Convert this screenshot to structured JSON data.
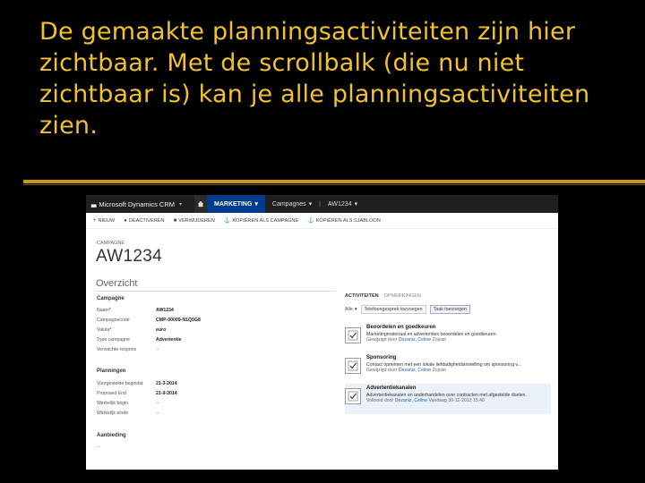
{
  "slide": {
    "title": "De gemaakte planningsactiviteiten zijn hier zichtbaar. Met de scrollbalk (die nu niet zichtbaar is) kan je alle planningsactiviteiten zien."
  },
  "navbar": {
    "logo_mark": "▃",
    "app_name": "Microsoft Dynamics CRM",
    "items": [
      {
        "label": "MARKETING"
      },
      {
        "label": "Campagnes"
      },
      {
        "label": "AW1234"
      }
    ]
  },
  "commands": [
    {
      "icon": "+",
      "label": "NIEUW"
    },
    {
      "icon": "●",
      "label": "DEACTIVEREN"
    },
    {
      "icon": "■",
      "label": "VERWIJDEREN"
    },
    {
      "icon": "⚓",
      "label": "KOPIËREN ALS CAMPAGNE"
    },
    {
      "icon": "⚓",
      "label": "KOPIËREN ALS SJABLOON"
    }
  ],
  "record": {
    "entity": "CAMPAGNE",
    "title": "AW1234",
    "section": "Overzicht"
  },
  "groups": {
    "campaign": {
      "title": "Campagne",
      "fields": [
        {
          "label": "Naam",
          "required": "*",
          "value": "AW1234",
          "bold": true
        },
        {
          "label": "Campagnecode",
          "required": "",
          "value": "CMP-00009-N1Q5G8",
          "bold": true
        },
        {
          "label": "Valuta",
          "required": "*",
          "value": "euro",
          "bold": true
        },
        {
          "label": "Type campagne",
          "required": "",
          "value": "Advertentie",
          "bold": true
        },
        {
          "label": "Verwachte respons",
          "required": "",
          "value": "--",
          "bold": false
        }
      ]
    },
    "planning": {
      "title": "Planningen",
      "fields": [
        {
          "label": "Voorgestelde begindat",
          "value": "21-3-2014",
          "bold": true
        },
        {
          "label": "Proposed End",
          "value": "21-9-2014",
          "bold": true
        },
        {
          "label": "Werkelijk begin",
          "value": "--",
          "bold": false
        },
        {
          "label": "Werkelijk einde",
          "value": "--",
          "bold": false
        }
      ]
    },
    "budget": {
      "title": "Aanbieding",
      "value": "--"
    }
  },
  "activities": {
    "tabs": [
      {
        "label": "ACTIVITEITEN",
        "active": true
      },
      {
        "label": "OPMERKINGEN",
        "active": false
      }
    ],
    "filter_value": "Alle",
    "filter_buttons": [
      {
        "label": "Telefoongesprek toevoegen"
      },
      {
        "label": "Taak toevoegen"
      }
    ],
    "items": [
      {
        "title": "Beoordelen en goedkeuren",
        "description": "Marketingmateriaal en advertenties beoordelen en goedkeuren.",
        "owner_prefix": "Gewijzigd door",
        "owner": "Dezaniz, Celine",
        "extra": "Zojuist",
        "highlight": false
      },
      {
        "title": "Sponsoring",
        "description": "Contact opnemen met een lokale liefdadigheidsinstelling om sponsoring v...",
        "owner_prefix": "Gewijzigd door",
        "owner": "Dezaniz, Celine",
        "extra": "Zojuist",
        "highlight": false
      },
      {
        "title": "Advertentiekanalen",
        "description": "Advertentiekanalen en onderhandelen over contracten met afgestelde doelen.",
        "owner_prefix": "Voltooid door",
        "owner": "Dezaniz, Celine",
        "extra": "Vandaag 30-11-2013 15:40",
        "highlight": true
      }
    ]
  },
  "colors": {
    "title": "#f2c12e",
    "divider": "#c89a14",
    "navbar": "#1f1f1f",
    "nav_active": "#003a8c",
    "link": "#1f5fb5"
  }
}
